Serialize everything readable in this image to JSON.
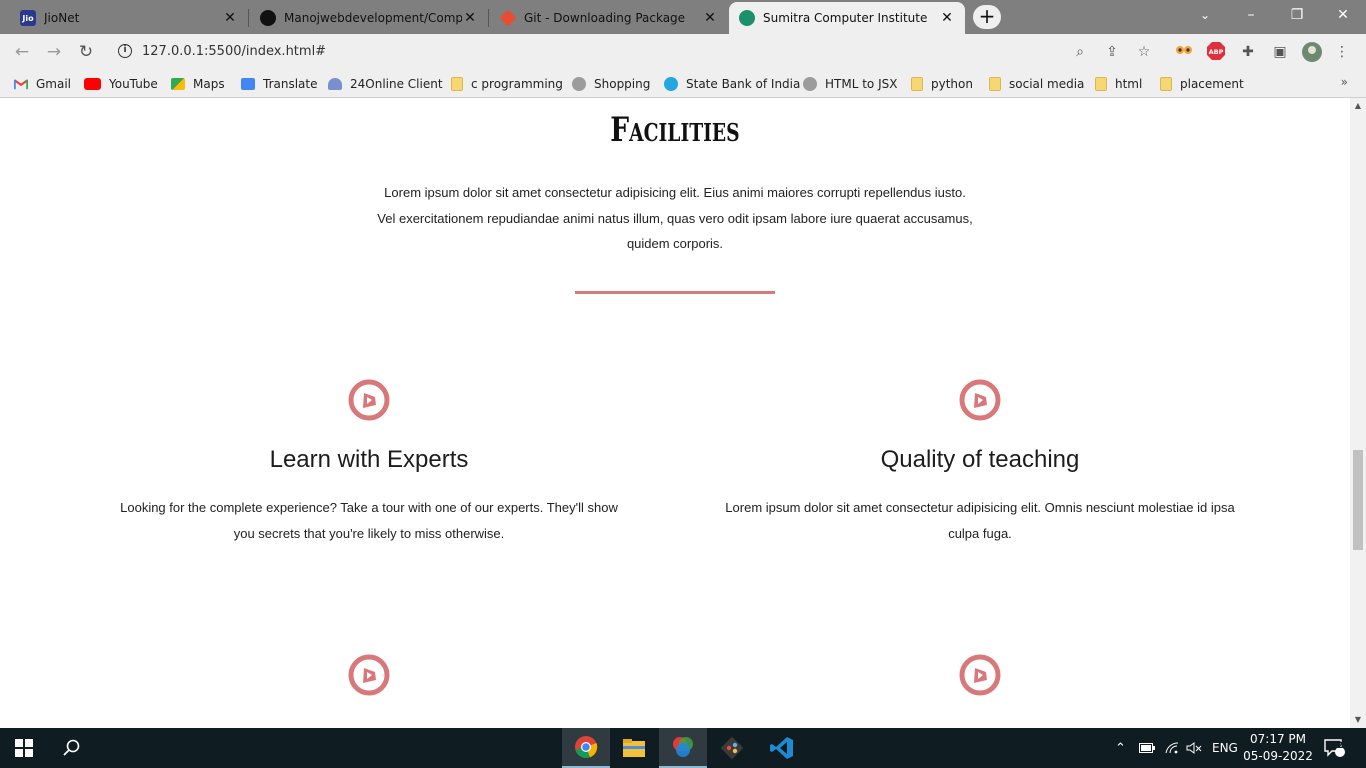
{
  "browser": {
    "tabs": [
      {
        "title": "JioNet",
        "favicon": "jio-icon",
        "active": false
      },
      {
        "title": "Manojwebdevelopment/Comput",
        "favicon": "github-icon",
        "active": false
      },
      {
        "title": "Git - Downloading Package",
        "favicon": "git-icon",
        "active": false
      },
      {
        "title": "Sumitra Computer Institute",
        "favicon": "site-icon",
        "active": true
      }
    ],
    "new_tab": "+",
    "url": "127.0.0.1:5500/index.html#",
    "window_controls": {
      "minimize": "–",
      "restore": "❐",
      "close": "✕"
    },
    "bookmarks": [
      {
        "label": "Gmail",
        "icon": "gmail-icon"
      },
      {
        "label": "YouTube",
        "icon": "youtube-icon"
      },
      {
        "label": "Maps",
        "icon": "maps-icon"
      },
      {
        "label": "Translate",
        "icon": "translate-icon"
      },
      {
        "label": "24Online Client",
        "icon": "24online-icon"
      },
      {
        "label": "c programming",
        "icon": "folder-icon"
      },
      {
        "label": "Shopping",
        "icon": "globe-icon"
      },
      {
        "label": "State Bank of India",
        "icon": "sbi-icon"
      },
      {
        "label": "HTML to JSX",
        "icon": "globe-icon"
      },
      {
        "label": "python",
        "icon": "folder-icon"
      },
      {
        "label": "social media",
        "icon": "folder-icon"
      },
      {
        "label": "html",
        "icon": "folder-icon"
      },
      {
        "label": "placement",
        "icon": "folder-icon"
      }
    ],
    "bookmarks_more": "»"
  },
  "page": {
    "heading": "Facilities",
    "intro": "Lorem ipsum dolor sit amet consectetur adipisicing elit. Eius animi maiores corrupti repellendus iusto. Vel exercitationem repudiandae animi natus illum, quas vero odit ipsam labore iure quaerat accusamus, quidem corporis.",
    "accent_color": "#d9787a",
    "features": [
      {
        "title": "Learn with Experts",
        "description": "Looking for the complete experience? Take a tour with one of our experts. They'll show you secrets that you're likely to miss otherwise.",
        "icon": "play-circle-icon"
      },
      {
        "title": "Quality of teaching",
        "description": "Lorem ipsum dolor sit amet consectetur adipisicing elit. Omnis nesciunt molestiae id ipsa culpa fuga.",
        "icon": "play-circle-icon"
      },
      {
        "title": "",
        "description": "",
        "icon": "play-circle-icon"
      },
      {
        "title": "",
        "description": "",
        "icon": "play-circle-icon"
      }
    ]
  },
  "taskbar": {
    "apps": [
      "chrome-icon",
      "file-explorer-icon",
      "paint-icon",
      "git-icon",
      "vscode-icon"
    ],
    "language": "ENG",
    "time": "07:17 PM",
    "date": "05-09-2022",
    "notifications": "2"
  }
}
